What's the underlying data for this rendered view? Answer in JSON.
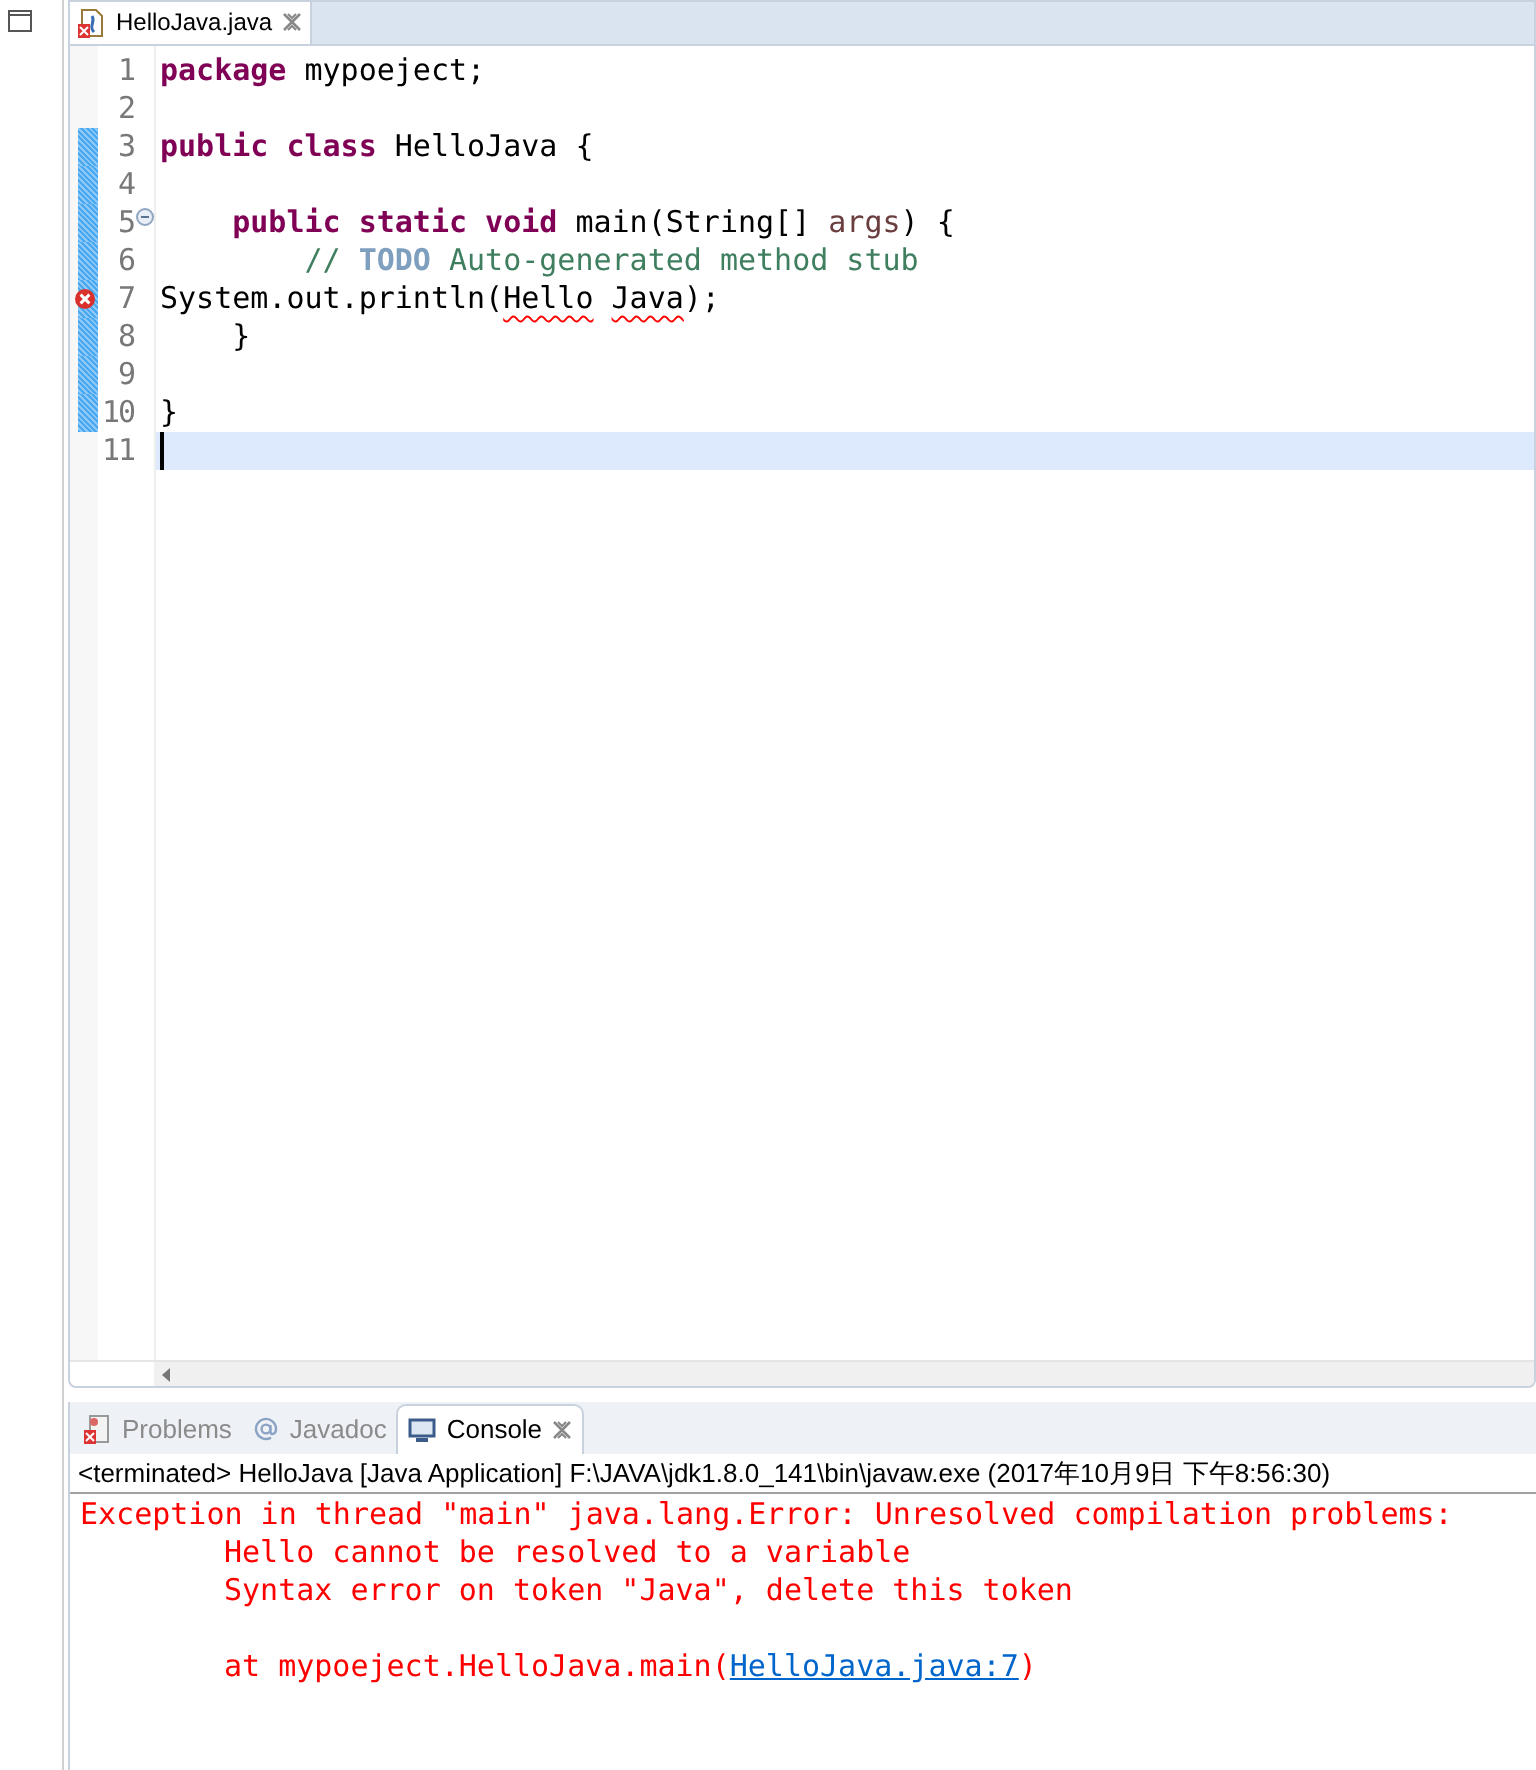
{
  "editor_tab": {
    "label": "HelloJava.java",
    "selected": true
  },
  "code_lines": [
    {
      "number": "1",
      "changed": false,
      "error": false,
      "foldable": false,
      "current": false,
      "segments": [
        {
          "kind": "keyword",
          "text": "package"
        },
        {
          "kind": "plain",
          "text": " mypoeject;"
        }
      ]
    },
    {
      "number": "2",
      "changed": false,
      "error": false,
      "foldable": false,
      "current": false
    },
    {
      "number": "3",
      "changed": true,
      "error": false,
      "foldable": false,
      "current": false,
      "segments": [
        {
          "kind": "keyword",
          "text": "public class"
        },
        {
          "kind": "plain",
          "text": " HelloJava {"
        }
      ]
    },
    {
      "number": "4",
      "changed": true,
      "error": false,
      "foldable": false,
      "current": false
    },
    {
      "number": "5",
      "changed": true,
      "error": false,
      "foldable": true,
      "current": false,
      "segments": [
        {
          "kind": "keyword",
          "text": "    public static void"
        },
        {
          "kind": "plain",
          "text": " main(String[] "
        },
        {
          "kind": "param",
          "text": "args"
        },
        {
          "kind": "plain",
          "text": ") {"
        }
      ]
    },
    {
      "number": "6",
      "changed": true,
      "error": false,
      "foldable": false,
      "current": false,
      "segments": [
        {
          "kind": "comment",
          "text": "        // "
        },
        {
          "kind": "todo",
          "text": "TODO"
        },
        {
          "kind": "comment",
          "text": " Auto-generated method stub"
        }
      ]
    },
    {
      "number": "7",
      "changed": true,
      "error": true,
      "foldable": false,
      "current": false,
      "segments": [
        {
          "kind": "plain",
          "text": "System.out.println("
        },
        {
          "kind": "error",
          "text": "Hello"
        },
        {
          "kind": "error",
          "text": " Java"
        },
        {
          "kind": "plain",
          "text": ");"
        }
      ]
    },
    {
      "number": "8",
      "changed": true,
      "error": false,
      "foldable": false,
      "current": false,
      "segments": [
        {
          "kind": "plain",
          "text": "    }"
        }
      ]
    },
    {
      "number": "9",
      "changed": true,
      "error": false,
      "foldable": false,
      "current": false
    },
    {
      "number": "10",
      "changed": true,
      "error": false,
      "foldable": false,
      "current": false,
      "segments": [
        {
          "kind": "plain",
          "text": "}"
        }
      ]
    },
    {
      "number": "11",
      "changed": false,
      "error": false,
      "foldable": false,
      "current": true
    }
  ],
  "panel_tabs": [
    {
      "kind": "problems",
      "label": "Problems",
      "selected": false
    },
    {
      "kind": "javadoc",
      "label": "Javadoc",
      "selected": false
    },
    {
      "kind": "console",
      "label": "Console",
      "selected": true
    }
  ],
  "console_header": "<terminated> HelloJava [Java Application] F:\\JAVA\\jdk1.8.0_141\\bin\\javaw.exe (2017年10月9日 下午8:56:30)",
  "console_lines": [
    {
      "kind": "message",
      "segments": [
        {
          "kind": "error",
          "text": "Exception in thread \"main\" java.lang.Error: Unresolved compilation problems:"
        }
      ]
    },
    {
      "kind": "detail",
      "segments": [
        {
          "kind": "error",
          "text": "Hello cannot be resolved to a variable"
        }
      ]
    },
    {
      "kind": "detail",
      "segments": [
        {
          "kind": "error",
          "text": "Syntax error on token \"Java\", delete this token"
        }
      ]
    },
    {
      "kind": "trace",
      "segments": [
        {
          "kind": "error",
          "text": "at mypoeject.HelloJava.main("
        },
        {
          "kind": "link",
          "text": "HelloJava.java:7"
        },
        {
          "kind": "error",
          "text": ")"
        }
      ]
    }
  ]
}
